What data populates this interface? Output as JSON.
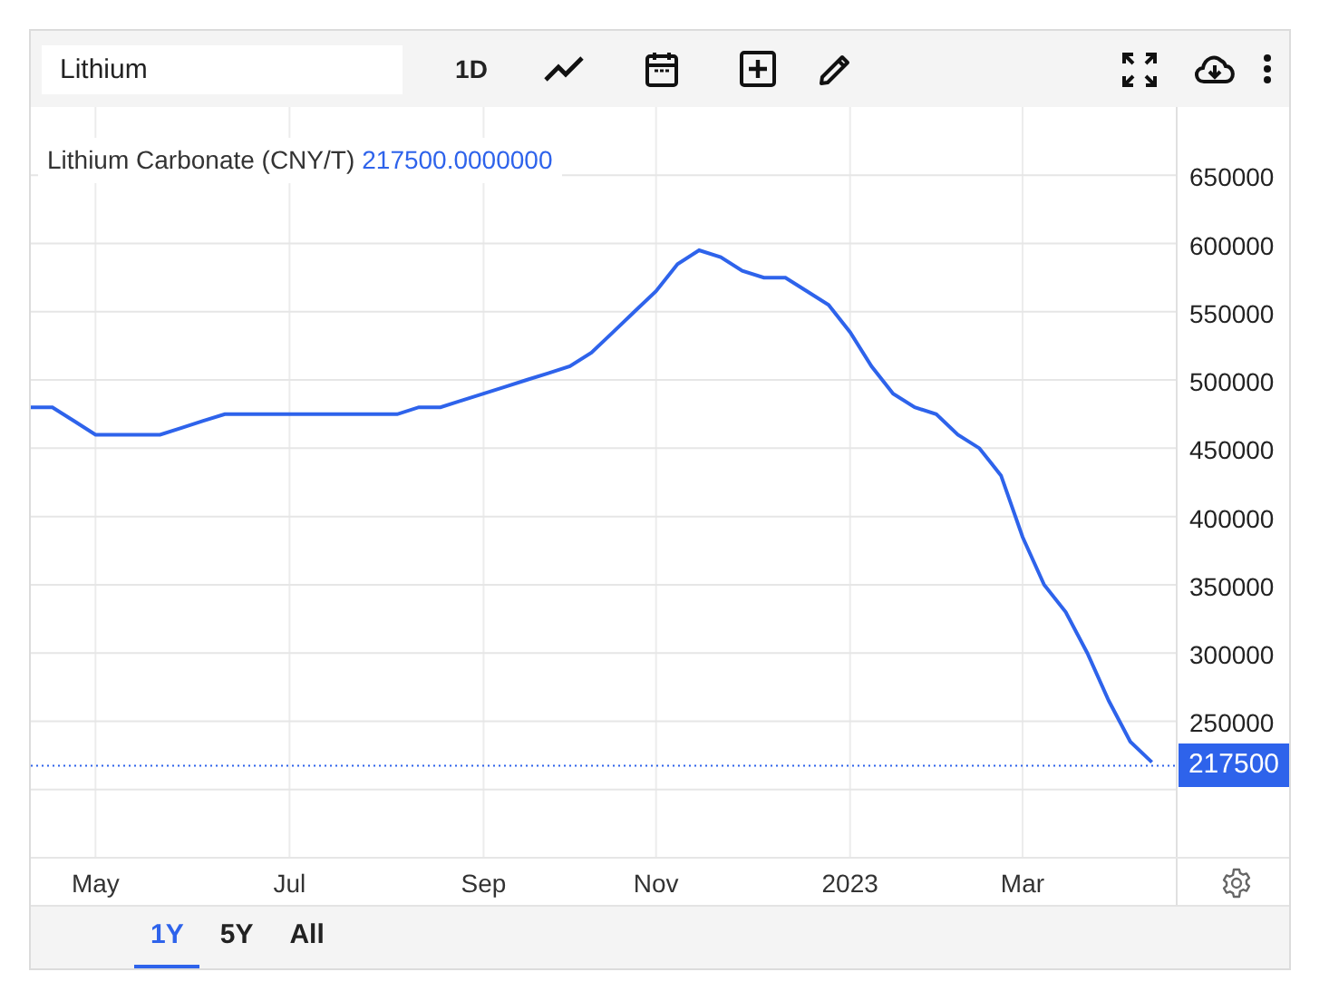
{
  "toolbar": {
    "search_field": {
      "value": "Lithium"
    },
    "interval_button": "1D"
  },
  "legend": {
    "value": "217500.0000000"
  },
  "last_value_badge": "217500",
  "chart_data": {
    "type": "line",
    "ylim": [
      150000,
      700000
    ],
    "categories": [
      null,
      null,
      null,
      "May",
      null,
      null,
      null,
      null,
      null,
      null,
      null,
      null,
      "Jul",
      null,
      null,
      null,
      null,
      null,
      null,
      null,
      null,
      "Sep",
      null,
      null,
      null,
      null,
      null,
      null,
      null,
      "Nov",
      null,
      null,
      null,
      null,
      null,
      null,
      null,
      null,
      "2023",
      null,
      null,
      null,
      null,
      null,
      null,
      null,
      "Mar",
      null,
      null,
      null,
      null,
      null,
      null
    ],
    "series": [
      {
        "name": "Lithium Carbonate (CNY/T)",
        "color": "#2e63eb",
        "values": [
          480000,
          480000,
          470000,
          460000,
          460000,
          460000,
          460000,
          465000,
          470000,
          475000,
          475000,
          475000,
          475000,
          475000,
          475000,
          475000,
          475000,
          475000,
          480000,
          480000,
          485000,
          490000,
          495000,
          500000,
          505000,
          510000,
          520000,
          535000,
          550000,
          565000,
          585000,
          595000,
          590000,
          580000,
          575000,
          575000,
          565000,
          555000,
          535000,
          510000,
          490000,
          480000,
          475000,
          460000,
          450000,
          430000,
          385000,
          350000,
          330000,
          300000,
          265000,
          235000,
          220000
        ]
      }
    ],
    "yticks": [
      650000,
      600000,
      550000,
      500000,
      450000,
      400000,
      350000,
      300000,
      250000
    ],
    "grid": true,
    "ref_lines": [
      {
        "axis": "y",
        "value": 217500,
        "color": "#2e63eb"
      }
    ]
  },
  "range_tabs": [
    {
      "label": "1Y",
      "selected": true
    },
    {
      "label": "5Y",
      "selected": false
    },
    {
      "label": "All",
      "selected": false
    }
  ]
}
